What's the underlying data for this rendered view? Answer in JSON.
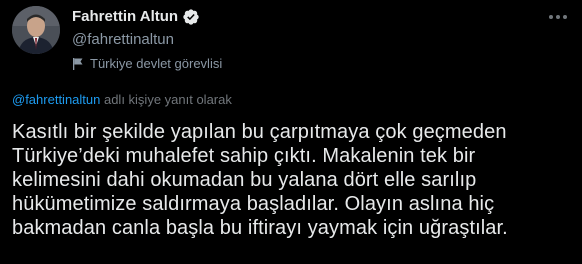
{
  "author": {
    "display_name": "Fahrettin Altun",
    "handle": "@fahrettinaltun",
    "label": "Türkiye devlet görevlisi",
    "verified_icon": "verified-badge-icon",
    "label_icon": "flag-icon",
    "avatar_icon": "avatar"
  },
  "reply": {
    "handle": "@fahrettinaltun",
    "suffix": " adlı kişiye yanıt olarak"
  },
  "tweet": {
    "text": "Kasıtlı bir şekilde yapılan bu çarpıtmaya çok geçmeden\nTürkiye’deki muhalefet sahip çıktı. Makalenin tek bir\nkelimesini dahi okumadan bu yalana dört elle sarılıp\nhükümetimize saldırmaya başladılar. Olayın aslına hiç\nbakmadan canla başla bu iftirayı yaymak için uğraştılar."
  },
  "colors": {
    "background": "#000000",
    "text_primary": "#e7e9ea",
    "text_secondary": "#8b98a5",
    "accent": "#1d9bf0"
  },
  "more_icon": "more-horizontal-icon"
}
